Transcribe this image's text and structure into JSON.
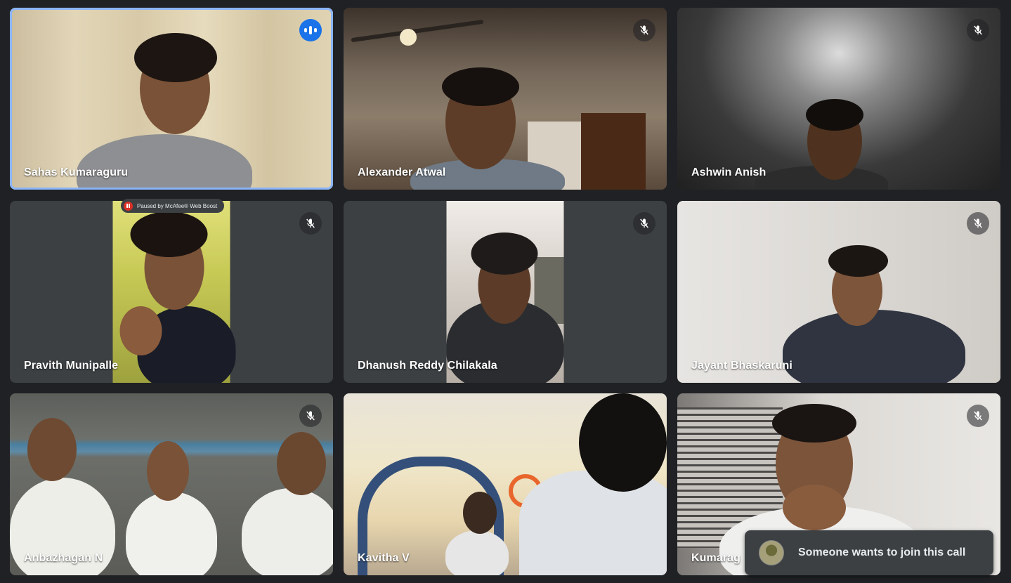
{
  "participants": [
    {
      "name": "Sahas Kumaraguru",
      "state": "speaking"
    },
    {
      "name": "Alexander Atwal",
      "state": "muted"
    },
    {
      "name": "Ashwin Anish",
      "state": "muted"
    },
    {
      "name": "Pravith Munipalle",
      "state": "muted"
    },
    {
      "name": "Dhanush Reddy Chilakala",
      "state": "muted"
    },
    {
      "name": "Jayant Bhaskaruni",
      "state": "muted"
    },
    {
      "name": "Anbazhagan N",
      "state": "muted"
    },
    {
      "name": "Kavitha V",
      "state": "muted"
    },
    {
      "name": "Kumarag",
      "state": "muted"
    }
  ],
  "overlay_badge": "Paused by McAfee® Web Boost",
  "notification": {
    "message": "Someone wants to join this call"
  },
  "colors": {
    "background": "#202124",
    "tile": "#3c4043",
    "active_speaker_border": "#8ab4f8",
    "speaking_indicator": "#1a73e8"
  }
}
